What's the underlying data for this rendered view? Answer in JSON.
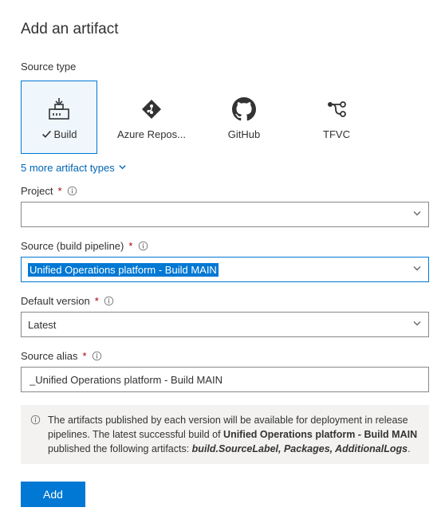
{
  "title": "Add an artifact",
  "sourceTypeLabel": "Source type",
  "sources": {
    "build": {
      "label": "Build"
    },
    "repos": {
      "label": "Azure Repos..."
    },
    "github": {
      "label": "GitHub"
    },
    "tfvc": {
      "label": "TFVC"
    }
  },
  "moreLink": "5 more artifact types",
  "fields": {
    "project": {
      "label": "Project",
      "value": ""
    },
    "pipeline": {
      "label": "Source (build pipeline)",
      "value": "Unified Operations platform - Build MAIN"
    },
    "defaultVersion": {
      "label": "Default version",
      "value": "Latest"
    },
    "sourceAlias": {
      "label": "Source alias",
      "value": "_Unified Operations platform - Build MAIN"
    }
  },
  "info": {
    "text1": "The artifacts published by each version will be available for deployment in release pipelines. The latest successful build of ",
    "bold1": "Unified Operations platform - Build MAIN",
    "text2": "  published the following artifacts: ",
    "bold2": "build.SourceLabel, Packages, AdditionalLogs",
    "text3": "."
  },
  "addButton": "Add"
}
